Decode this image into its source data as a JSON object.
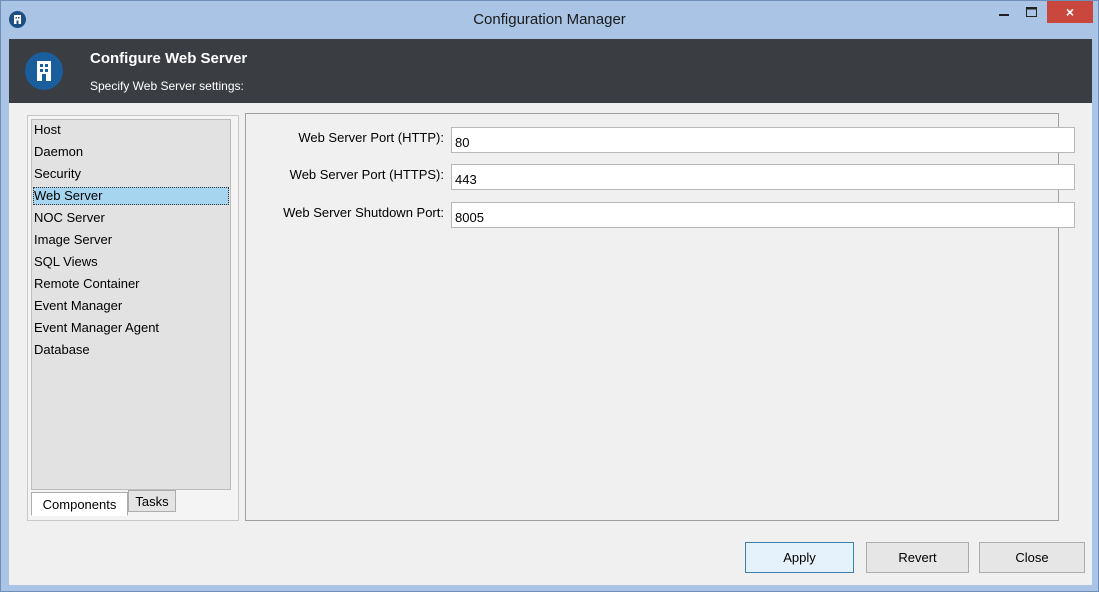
{
  "window": {
    "title": "Configuration Manager",
    "close_glyph": "×",
    "icon": "app-hotel-icon"
  },
  "banner": {
    "title": "Configure Web Server",
    "subtitle": "Specify Web Server settings:"
  },
  "components": {
    "items": [
      {
        "label": "Host"
      },
      {
        "label": "Daemon"
      },
      {
        "label": "Security"
      },
      {
        "label": "Web Server",
        "selected": true
      },
      {
        "label": "NOC Server"
      },
      {
        "label": "Image Server"
      },
      {
        "label": "SQL Views"
      },
      {
        "label": "Remote Container"
      },
      {
        "label": "Event Manager"
      },
      {
        "label": "Event Manager Agent"
      },
      {
        "label": "Database"
      }
    ],
    "tabs": [
      {
        "label": "Components",
        "active": true
      },
      {
        "label": "Tasks",
        "active": false
      }
    ]
  },
  "form": {
    "fields": [
      {
        "label": "Web Server Port (HTTP):",
        "value": "80"
      },
      {
        "label": "Web Server Port (HTTPS):",
        "value": "443"
      },
      {
        "label": "Web Server Shutdown Port:",
        "value": "8005"
      }
    ]
  },
  "buttons": {
    "apply": "Apply",
    "revert": "Revert",
    "close": "Close"
  },
  "colors": {
    "titlebar": "#a9c4e4",
    "banner": "#3a3d42",
    "selection": "#a6d5f0",
    "close_button": "#c9473c"
  }
}
